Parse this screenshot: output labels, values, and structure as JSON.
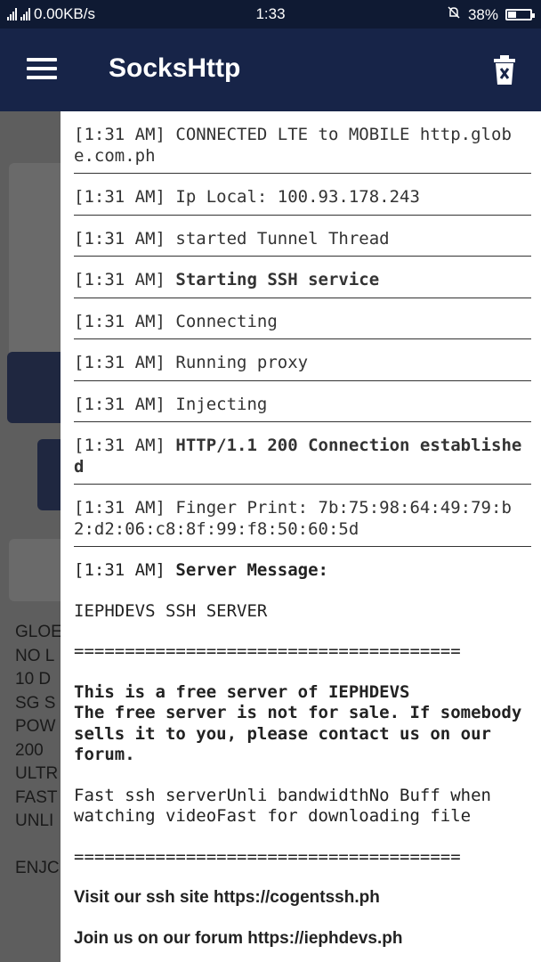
{
  "status_bar": {
    "network_speed": "0.00KB/s",
    "time": "1:33",
    "battery": "38%",
    "battery_level": 0.38
  },
  "app_bar": {
    "title": "SocksHttp",
    "menu_icon": "hamburger-menu-icon",
    "clear_icon": "trash-delete-icon"
  },
  "background": {
    "text_lines": [
      "GLOE",
      "NO L",
      "10 D",
      "SG S",
      "POW",
      "200",
      "ULTR",
      "FAST",
      "UNLI",
      "",
      "ENJC"
    ]
  },
  "log": {
    "entries": [
      {
        "time": "[1:31 AM]",
        "message": "CONNECTED LTE to MOBILE http.globe.com.ph",
        "bold": false
      },
      {
        "time": "[1:31 AM]",
        "message": "Ip Local: 100.93.178.243",
        "bold": false
      },
      {
        "time": "[1:31 AM]",
        "message": "started Tunnel Thread",
        "bold": false
      },
      {
        "time": "[1:31 AM]",
        "message": "Starting SSH service",
        "bold": true
      },
      {
        "time": "[1:31 AM]",
        "message": "Connecting",
        "bold": false
      },
      {
        "time": "[1:31 AM]",
        "message": "Running proxy",
        "bold": false
      },
      {
        "time": "[1:31 AM]",
        "message": "Injecting",
        "bold": false
      },
      {
        "time": "[1:31 AM]",
        "message": "HTTP/1.1 200 Connection established",
        "bold": true
      },
      {
        "time": "[1:31 AM]",
        "message": "Finger Print: 7b:75:98:64:49:79:b2:d2:06:c8:8f:99:f8:50:60:5d",
        "bold": false
      }
    ],
    "server_message": {
      "time": "[1:31 AM]",
      "label": "Server Message:",
      "heading": "IEPHDEVS SSH SERVER",
      "separator": "======================================",
      "bold_paragraph": "This is a free server of IEPHDEVS\nThe free server is not for sale. If somebody sells it to you, please contact us on our forum.",
      "plain_paragraph": "Fast ssh serverUnli bandwidthNo Buff when watching videoFast for downloading file",
      "separator2": "======================================",
      "site_line": "Visit our ssh site https://cogentssh.ph",
      "forum_line": "Join us on our forum https://iephdevs.ph"
    }
  }
}
